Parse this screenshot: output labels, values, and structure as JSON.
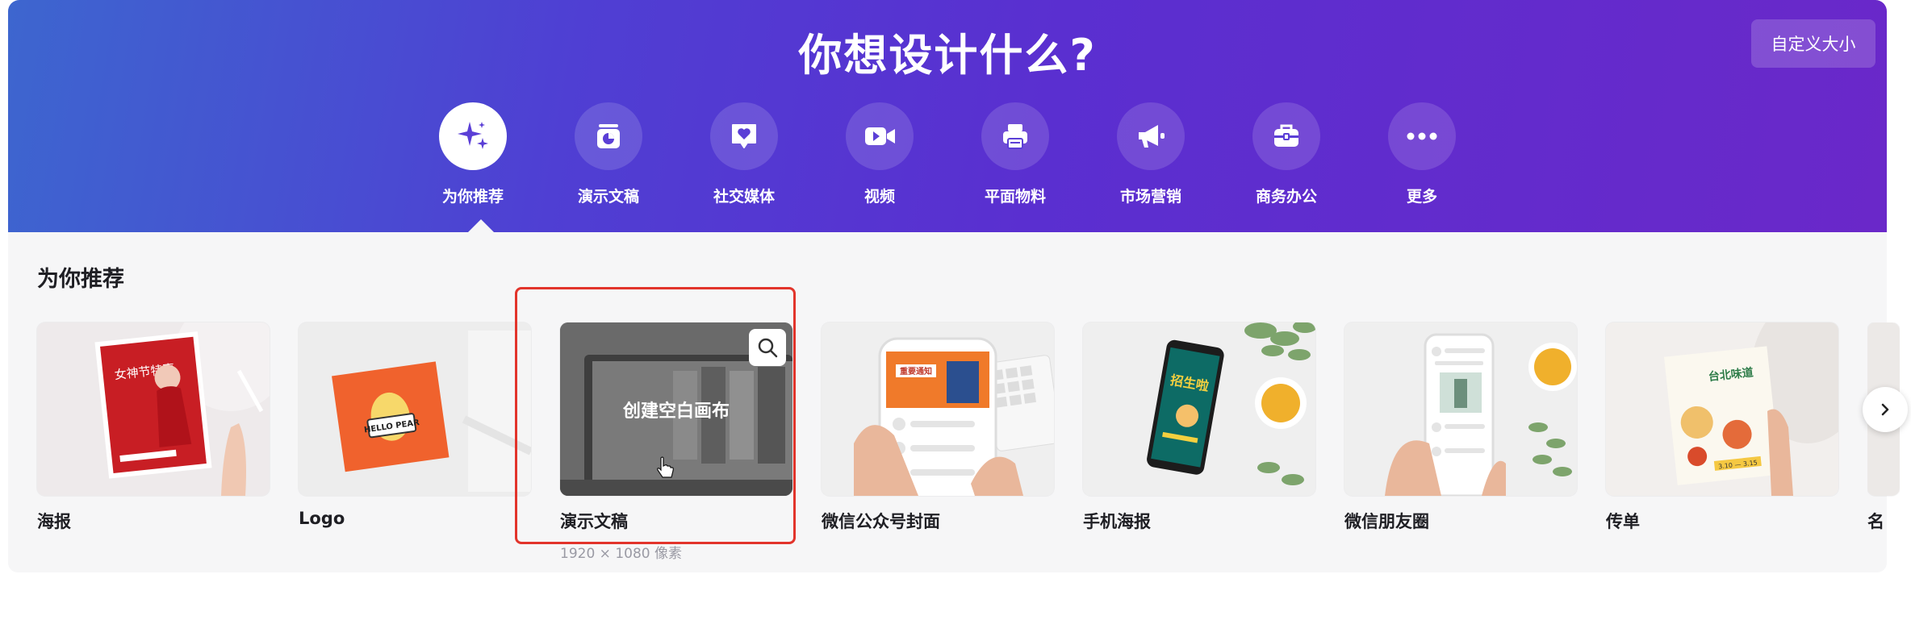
{
  "hero": {
    "title": "你想设计什么?",
    "custom_size_label": "自定义大小",
    "categories": [
      {
        "label": "为你推荐",
        "icon": "sparkle-icon",
        "active": true
      },
      {
        "label": "演示文稿",
        "icon": "presentation-icon",
        "active": false
      },
      {
        "label": "社交媒体",
        "icon": "heart-chat-icon",
        "active": false
      },
      {
        "label": "视频",
        "icon": "video-camera-icon",
        "active": false
      },
      {
        "label": "平面物料",
        "icon": "printer-icon",
        "active": false
      },
      {
        "label": "市场营销",
        "icon": "megaphone-icon",
        "active": false
      },
      {
        "label": "商务办公",
        "icon": "briefcase-icon",
        "active": false
      },
      {
        "label": "更多",
        "icon": "more-dots-icon",
        "active": false
      }
    ]
  },
  "recommend": {
    "section_title": "为你推荐",
    "cards": [
      {
        "name": "海报"
      },
      {
        "name": "Logo"
      },
      {
        "name": "演示文稿",
        "overlay": "创建空白画布",
        "sub": "1920 × 1080 像素"
      },
      {
        "name": "微信公众号封面"
      },
      {
        "name": "手机海报"
      },
      {
        "name": "微信朋友圈"
      },
      {
        "name": "传单"
      },
      {
        "name": "名"
      }
    ],
    "thumb_text": {
      "poster_title": "女神节特惠",
      "logo_text": "HELLO PEAR",
      "wechat_notice": "重要通知",
      "mobile_poster": "招生啦",
      "flyer_title": "台北味道",
      "flyer_date": "3.10 — 3.15"
    }
  },
  "colors": {
    "gradient_start": "#3d66cf",
    "gradient_end": "#6a28c9",
    "highlight": "#e2342b"
  }
}
